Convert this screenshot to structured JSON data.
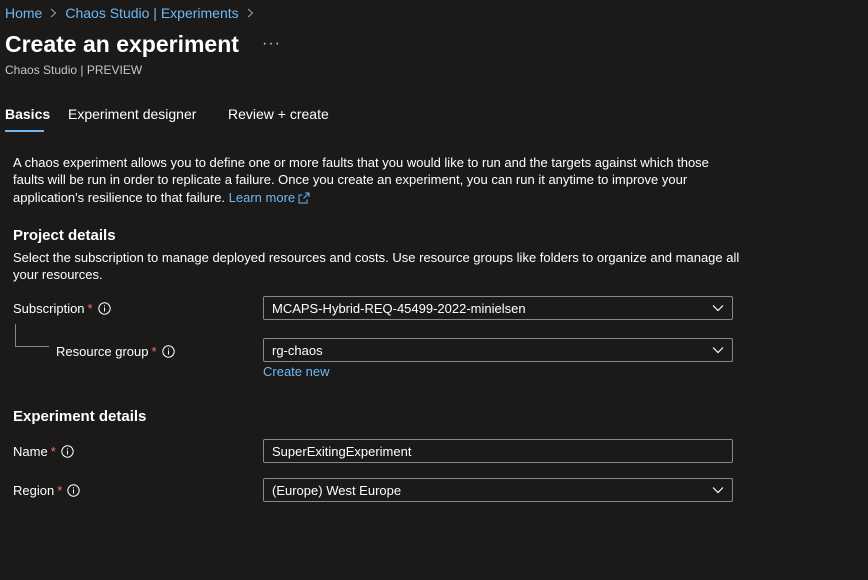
{
  "breadcrumb": {
    "items": [
      "Home",
      "Chaos Studio | Experiments"
    ]
  },
  "header": {
    "title": "Create an experiment",
    "more": "···",
    "subtitle": "Chaos Studio | PREVIEW"
  },
  "tabs": [
    {
      "label": "Basics",
      "active": true
    },
    {
      "label": "Experiment designer",
      "active": false
    },
    {
      "label": "Review + create",
      "active": false
    }
  ],
  "intro": {
    "text": "A chaos experiment allows you to define one or more faults that you would like to run and the targets against which those faults will be run in order to replicate a failure. Once you create an experiment, you can run it anytime to improve your application's resilience to that failure. ",
    "learn_more": "Learn more"
  },
  "project": {
    "title": "Project details",
    "description": "Select the subscription to manage deployed resources and costs. Use resource groups like folders to organize and manage all your resources.",
    "subscription_label": "Subscription",
    "subscription_value": "MCAPS-Hybrid-REQ-45499-2022-minielsen",
    "resource_group_label": "Resource group",
    "resource_group_value": "rg-chaos",
    "create_new": "Create new"
  },
  "experiment": {
    "title": "Experiment details",
    "name_label": "Name",
    "name_value": "SuperExitingExperiment",
    "region_label": "Region",
    "region_value": "(Europe) West Europe"
  },
  "required_marker": "*",
  "colors": {
    "background": "#1b1a19",
    "accent": "#6cb8f6",
    "required": "#f1707b",
    "border": "#8a8886"
  }
}
